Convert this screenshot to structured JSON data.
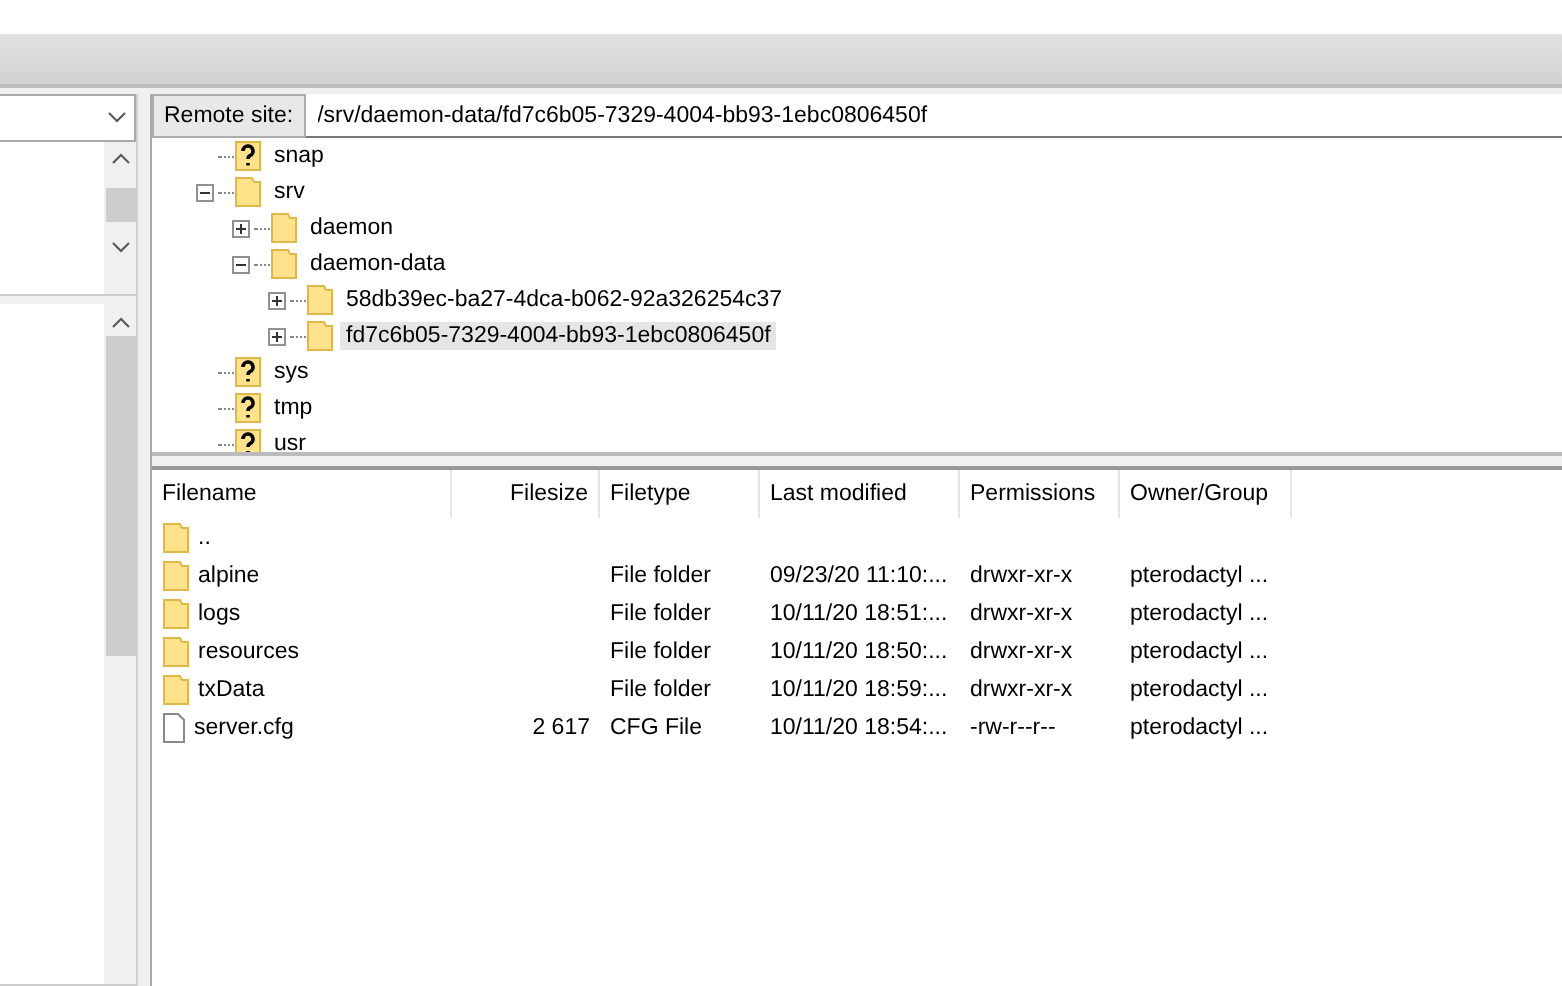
{
  "remote_site": {
    "label": "Remote site:",
    "path": "/srv/daemon-data/fd7c6b05-7329-4004-bb93-1ebc0806450f"
  },
  "tree": [
    {
      "name": "snap",
      "kind": "unknown",
      "selected": false
    },
    {
      "name": "srv",
      "kind": "folder",
      "expanded": true,
      "selected": false,
      "children": [
        {
          "name": "daemon",
          "kind": "folder",
          "expanded": false,
          "selected": false
        },
        {
          "name": "daemon-data",
          "kind": "folder",
          "expanded": true,
          "selected": false,
          "children": [
            {
              "name": "58db39ec-ba27-4dca-b062-92a326254c37",
              "kind": "folder",
              "expanded": false,
              "selected": false
            },
            {
              "name": "fd7c6b05-7329-4004-bb93-1ebc0806450f",
              "kind": "folder",
              "expanded": false,
              "selected": true
            }
          ]
        }
      ]
    },
    {
      "name": "sys",
      "kind": "unknown",
      "selected": false
    },
    {
      "name": "tmp",
      "kind": "unknown",
      "selected": false
    },
    {
      "name": "usr",
      "kind": "unknown",
      "selected": false
    }
  ],
  "file_list": {
    "columns": [
      "Filename",
      "Filesize",
      "Filetype",
      "Last modified",
      "Permissions",
      "Owner/Group"
    ],
    "rows": [
      {
        "kind": "folder",
        "name": ".."
      },
      {
        "kind": "folder",
        "name": "alpine",
        "type": "File folder",
        "modified": "09/23/20 11:10:...",
        "permissions": "drwxr-xr-x",
        "owner": "pterodactyl ..."
      },
      {
        "kind": "folder",
        "name": "logs",
        "type": "File folder",
        "modified": "10/11/20 18:51:...",
        "permissions": "drwxr-xr-x",
        "owner": "pterodactyl ..."
      },
      {
        "kind": "folder",
        "name": "resources",
        "type": "File folder",
        "modified": "10/11/20 18:50:...",
        "permissions": "drwxr-xr-x",
        "owner": "pterodactyl ..."
      },
      {
        "kind": "folder",
        "name": "txData",
        "type": "File folder",
        "modified": "10/11/20 18:59:...",
        "permissions": "drwxr-xr-x",
        "owner": "pterodactyl ..."
      },
      {
        "kind": "file",
        "name": "server.cfg",
        "size": "2 617",
        "type": "CFG File",
        "modified": "10/11/20 18:54:...",
        "permissions": "-rw-r--r--",
        "owner": "pterodactyl ..."
      }
    ]
  }
}
